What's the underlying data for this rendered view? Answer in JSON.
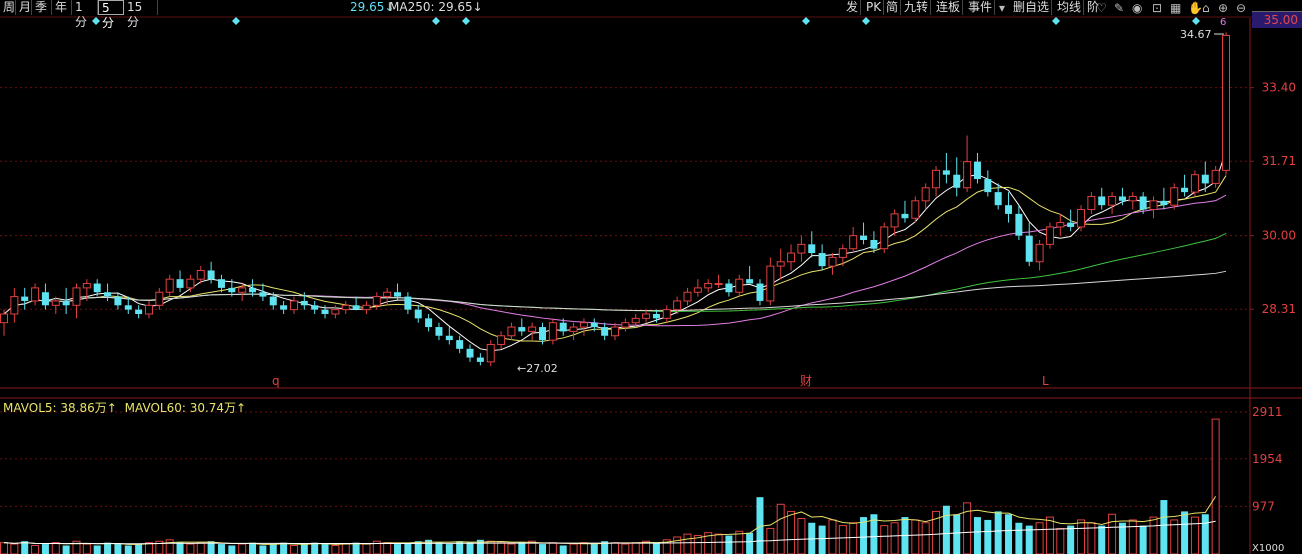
{
  "toolbar_left": {
    "tabs": [
      {
        "label": "周",
        "active": false
      },
      {
        "label": "月",
        "active": false
      },
      {
        "label": "季",
        "active": false
      },
      {
        "label": "年",
        "active": false
      },
      {
        "label": "1分",
        "active": false
      },
      {
        "label": "5分",
        "active": true
      },
      {
        "label": "15分",
        "active": false
      }
    ],
    "ma_partial": "29.65↓",
    "ma250_label": "MA250: 29.65↓"
  },
  "toolbar_right": {
    "items": [
      "发",
      "PK",
      "简",
      "九转",
      "连板",
      "事件",
      "删自选",
      "均线",
      "阶"
    ],
    "icons": [
      "heart-icon",
      "pen-icon",
      "eye-icon",
      "lock-icon",
      "grid-icon",
      "hand-icon",
      "home-icon",
      "zoom-in-icon",
      "zoom-out-icon"
    ]
  },
  "colors": {
    "up": "#e04040",
    "down": "#5fe3f0",
    "ma5": "#ffffff",
    "ma10": "#e8e36a",
    "ma30": "#e27ee6",
    "ma60": "#3fc43f",
    "ma250": "#d8d8d8",
    "accent": "#e04a4a",
    "grid": "#6b0f0f"
  },
  "price_axis": {
    "top_box": "35.00",
    "ticks": [
      "33.40",
      "31.71",
      "30.00",
      "28.31"
    ],
    "high_label": "34.67",
    "low_label": "27.02"
  },
  "volume_axis": {
    "ticks": [
      "2911",
      "1954",
      "977"
    ],
    "bottom_partial": "X1000"
  },
  "volume_legend": {
    "mavol5": "MAVOL5: 38.86万↑",
    "mavol60": "MAVOL60: 30.74万↑"
  },
  "markers": {
    "q": "q",
    "cai": "财",
    "L": "L",
    "top_count": "6"
  },
  "chart_data": {
    "type": "candlestick",
    "ylim": [
      26.5,
      35.0
    ],
    "candles": [
      [
        28.0,
        28.3,
        27.7,
        28.2
      ],
      [
        28.2,
        28.8,
        28.0,
        28.6
      ],
      [
        28.6,
        28.8,
        28.3,
        28.5
      ],
      [
        28.5,
        28.9,
        28.4,
        28.8
      ],
      [
        28.7,
        28.9,
        28.3,
        28.4
      ],
      [
        28.4,
        28.6,
        28.2,
        28.5
      ],
      [
        28.5,
        28.8,
        28.2,
        28.4
      ],
      [
        28.4,
        28.9,
        28.1,
        28.8
      ],
      [
        28.8,
        29.0,
        28.5,
        28.9
      ],
      [
        28.9,
        29.0,
        28.6,
        28.7
      ],
      [
        28.7,
        28.9,
        28.5,
        28.6
      ],
      [
        28.6,
        28.7,
        28.3,
        28.4
      ],
      [
        28.4,
        28.6,
        28.2,
        28.3
      ],
      [
        28.3,
        28.4,
        28.1,
        28.2
      ],
      [
        28.2,
        28.5,
        28.1,
        28.4
      ],
      [
        28.4,
        28.8,
        28.3,
        28.7
      ],
      [
        28.7,
        29.1,
        28.6,
        29.0
      ],
      [
        29.0,
        29.2,
        28.7,
        28.8
      ],
      [
        28.8,
        29.1,
        28.7,
        29.0
      ],
      [
        29.0,
        29.3,
        28.9,
        29.2
      ],
      [
        29.2,
        29.4,
        28.9,
        29.0
      ],
      [
        29.0,
        29.1,
        28.7,
        28.8
      ],
      [
        28.8,
        29.0,
        28.6,
        28.7
      ],
      [
        28.7,
        28.9,
        28.5,
        28.8
      ],
      [
        28.8,
        29.0,
        28.6,
        28.7
      ],
      [
        28.7,
        28.9,
        28.5,
        28.6
      ],
      [
        28.6,
        28.7,
        28.3,
        28.4
      ],
      [
        28.4,
        28.5,
        28.2,
        28.3
      ],
      [
        28.3,
        28.6,
        28.2,
        28.5
      ],
      [
        28.5,
        28.7,
        28.3,
        28.4
      ],
      [
        28.4,
        28.5,
        28.2,
        28.3
      ],
      [
        28.3,
        28.4,
        28.1,
        28.2
      ],
      [
        28.2,
        28.4,
        28.1,
        28.3
      ],
      [
        28.3,
        28.5,
        28.2,
        28.4
      ],
      [
        28.4,
        28.6,
        28.3,
        28.3
      ],
      [
        28.3,
        28.5,
        28.2,
        28.4
      ],
      [
        28.4,
        28.7,
        28.3,
        28.6
      ],
      [
        28.6,
        28.8,
        28.4,
        28.7
      ],
      [
        28.7,
        28.9,
        28.5,
        28.6
      ],
      [
        28.6,
        28.7,
        28.2,
        28.3
      ],
      [
        28.3,
        28.4,
        28.0,
        28.1
      ],
      [
        28.1,
        28.2,
        27.8,
        27.9
      ],
      [
        27.9,
        28.0,
        27.6,
        27.7
      ],
      [
        27.7,
        27.9,
        27.5,
        27.6
      ],
      [
        27.6,
        27.7,
        27.3,
        27.4
      ],
      [
        27.4,
        27.5,
        27.1,
        27.2
      ],
      [
        27.2,
        27.3,
        27.02,
        27.1
      ],
      [
        27.1,
        27.6,
        27.0,
        27.5
      ],
      [
        27.5,
        27.8,
        27.4,
        27.7
      ],
      [
        27.7,
        28.0,
        27.6,
        27.9
      ],
      [
        27.9,
        28.1,
        27.7,
        27.8
      ],
      [
        27.8,
        28.0,
        27.6,
        27.9
      ],
      [
        27.9,
        28.0,
        27.5,
        27.6
      ],
      [
        27.6,
        28.1,
        27.5,
        28.0
      ],
      [
        28.0,
        28.1,
        27.7,
        27.8
      ],
      [
        27.8,
        28.0,
        27.6,
        27.9
      ],
      [
        27.9,
        28.1,
        27.7,
        28.0
      ],
      [
        28.0,
        28.1,
        27.8,
        27.9
      ],
      [
        27.9,
        28.0,
        27.6,
        27.7
      ],
      [
        27.7,
        28.0,
        27.6,
        27.9
      ],
      [
        27.9,
        28.1,
        27.8,
        28.0
      ],
      [
        28.0,
        28.2,
        27.9,
        28.1
      ],
      [
        28.1,
        28.3,
        28.0,
        28.2
      ],
      [
        28.2,
        28.3,
        28.0,
        28.1
      ],
      [
        28.1,
        28.4,
        28.0,
        28.3
      ],
      [
        28.3,
        28.6,
        28.2,
        28.5
      ],
      [
        28.5,
        28.8,
        28.4,
        28.7
      ],
      [
        28.7,
        29.0,
        28.6,
        28.8
      ],
      [
        28.8,
        29.0,
        28.7,
        28.9
      ],
      [
        28.9,
        29.1,
        28.8,
        28.9
      ],
      [
        28.9,
        29.0,
        28.6,
        28.7
      ],
      [
        28.7,
        29.1,
        28.6,
        29.0
      ],
      [
        29.0,
        29.3,
        28.9,
        28.9
      ],
      [
        28.9,
        29.0,
        28.4,
        28.5
      ],
      [
        28.5,
        29.5,
        28.4,
        29.3
      ],
      [
        29.3,
        29.7,
        29.0,
        29.4
      ],
      [
        29.4,
        29.8,
        29.2,
        29.6
      ],
      [
        29.6,
        30.0,
        29.4,
        29.8
      ],
      [
        29.8,
        30.1,
        29.5,
        29.6
      ],
      [
        29.6,
        29.8,
        29.2,
        29.3
      ],
      [
        29.3,
        29.6,
        29.1,
        29.5
      ],
      [
        29.5,
        29.8,
        29.3,
        29.7
      ],
      [
        29.7,
        30.2,
        29.6,
        30.0
      ],
      [
        30.0,
        30.3,
        29.8,
        29.9
      ],
      [
        29.9,
        30.1,
        29.6,
        29.7
      ],
      [
        29.7,
        30.3,
        29.6,
        30.2
      ],
      [
        30.2,
        30.6,
        30.0,
        30.5
      ],
      [
        30.5,
        30.8,
        30.3,
        30.4
      ],
      [
        30.4,
        30.9,
        30.3,
        30.8
      ],
      [
        30.8,
        31.2,
        30.6,
        31.1
      ],
      [
        31.1,
        31.6,
        30.9,
        31.5
      ],
      [
        31.5,
        31.9,
        31.2,
        31.4
      ],
      [
        31.4,
        31.8,
        30.9,
        31.1
      ],
      [
        31.1,
        32.3,
        31.0,
        31.7
      ],
      [
        31.7,
        31.9,
        31.2,
        31.3
      ],
      [
        31.3,
        31.5,
        30.9,
        31.0
      ],
      [
        31.0,
        31.2,
        30.6,
        30.7
      ],
      [
        30.7,
        31.0,
        30.3,
        30.5
      ],
      [
        30.5,
        30.7,
        29.9,
        30.0
      ],
      [
        30.0,
        30.3,
        29.3,
        29.4
      ],
      [
        29.4,
        29.9,
        29.2,
        29.8
      ],
      [
        29.8,
        30.3,
        29.7,
        30.2
      ],
      [
        30.2,
        30.5,
        30.0,
        30.3
      ],
      [
        30.3,
        30.6,
        30.1,
        30.2
      ],
      [
        30.2,
        30.7,
        30.1,
        30.6
      ],
      [
        30.6,
        31.0,
        30.5,
        30.9
      ],
      [
        30.9,
        31.1,
        30.6,
        30.7
      ],
      [
        30.7,
        31.0,
        30.5,
        30.9
      ],
      [
        30.9,
        31.1,
        30.7,
        30.8
      ],
      [
        30.8,
        31.0,
        30.6,
        30.9
      ],
      [
        30.9,
        31.0,
        30.5,
        30.6
      ],
      [
        30.6,
        30.9,
        30.4,
        30.8
      ],
      [
        30.8,
        31.1,
        30.6,
        30.7
      ],
      [
        30.7,
        31.2,
        30.6,
        31.1
      ],
      [
        31.1,
        31.4,
        30.9,
        31.0
      ],
      [
        31.0,
        31.5,
        30.9,
        31.4
      ],
      [
        31.4,
        31.7,
        31.0,
        31.2
      ],
      [
        31.2,
        31.6,
        31.1,
        31.5
      ],
      [
        31.5,
        34.67,
        31.4,
        34.6
      ]
    ],
    "volumes": [
      8,
      7,
      9,
      6,
      7,
      8,
      6,
      9,
      7,
      6,
      8,
      7,
      6,
      7,
      8,
      9,
      10,
      8,
      7,
      8,
      9,
      7,
      6,
      7,
      8,
      6,
      7,
      8,
      6,
      7,
      8,
      7,
      6,
      7,
      8,
      7,
      9,
      8,
      7,
      8,
      9,
      10,
      8,
      7,
      9,
      8,
      10,
      9,
      8,
      7,
      8,
      9,
      7,
      8,
      6,
      7,
      8,
      7,
      9,
      8,
      7,
      8,
      9,
      8,
      10,
      12,
      14,
      13,
      15,
      14,
      13,
      16,
      15,
      40,
      18,
      35,
      30,
      25,
      22,
      20,
      24,
      20,
      22,
      26,
      28,
      20,
      22,
      26,
      24,
      22,
      30,
      34,
      28,
      36,
      26,
      24,
      30,
      28,
      22,
      20,
      22,
      26,
      18,
      20,
      24,
      22,
      20,
      28,
      22,
      24,
      20,
      26,
      38,
      24,
      30,
      26,
      28,
      95
    ]
  }
}
